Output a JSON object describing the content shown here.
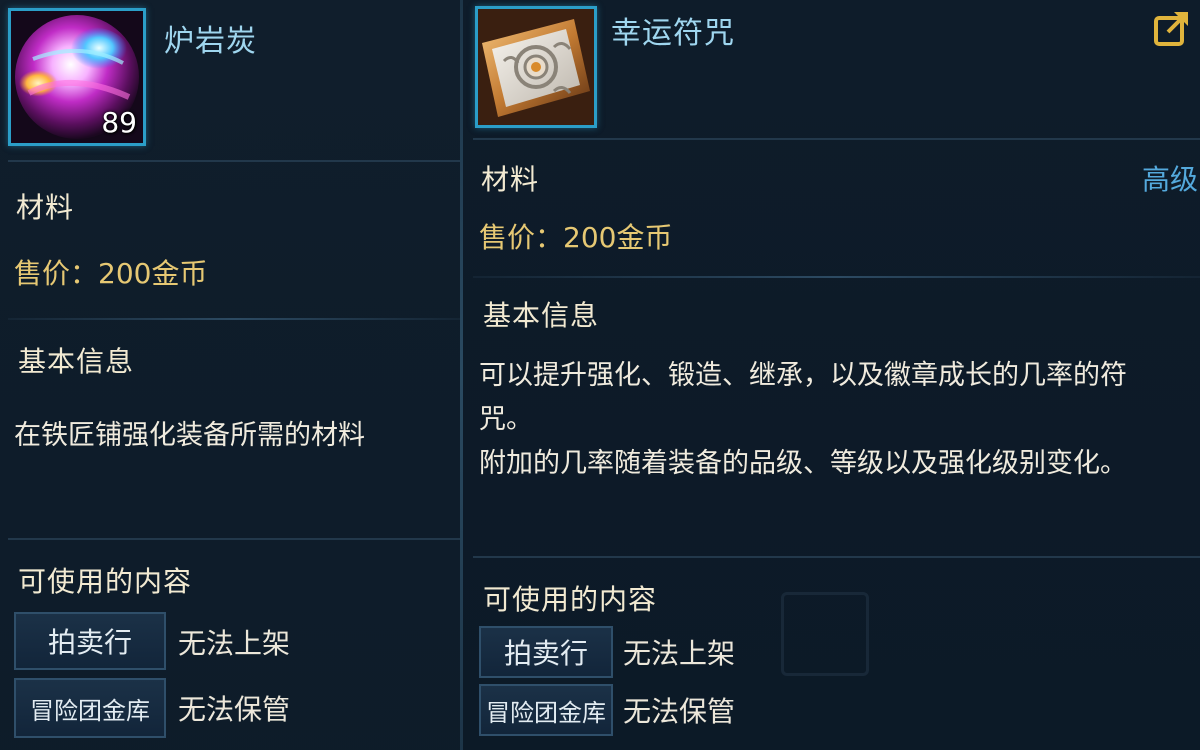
{
  "left_item": {
    "name": "炉岩炭",
    "stack_count": "89",
    "icon": "orb-icon",
    "category": "材料",
    "price": "售价：200金币",
    "section_basic": "基本信息",
    "description": "在铁匠铺强化装备所需的材料",
    "section_usage": "可使用的内容",
    "usage": [
      {
        "button": "拍卖行",
        "status": "无法上架"
      },
      {
        "button": "冒险团金库",
        "status": "无法保管"
      }
    ]
  },
  "right_item": {
    "name": "幸运符咒",
    "icon": "talisman-icon",
    "category": "材料",
    "grade": "高级",
    "price": "售价：200金币",
    "section_basic": "基本信息",
    "description_lines": [
      "可以提升强化、锻造、继承，以及徽章成长的几率的符",
      "咒。",
      "附加的几率随着装备的品级、等级以及强化级别变化。"
    ],
    "section_usage": "可使用的内容",
    "usage": [
      {
        "button": "拍卖行",
        "status": "无法上架"
      },
      {
        "button": "冒险团金库",
        "status": "无法保管"
      }
    ]
  },
  "share_icon": "share-icon",
  "colors": {
    "frame": "#2b9ec8",
    "name": "#9fd6ef",
    "price": "#e6c873",
    "grade": "#54a9dc"
  }
}
